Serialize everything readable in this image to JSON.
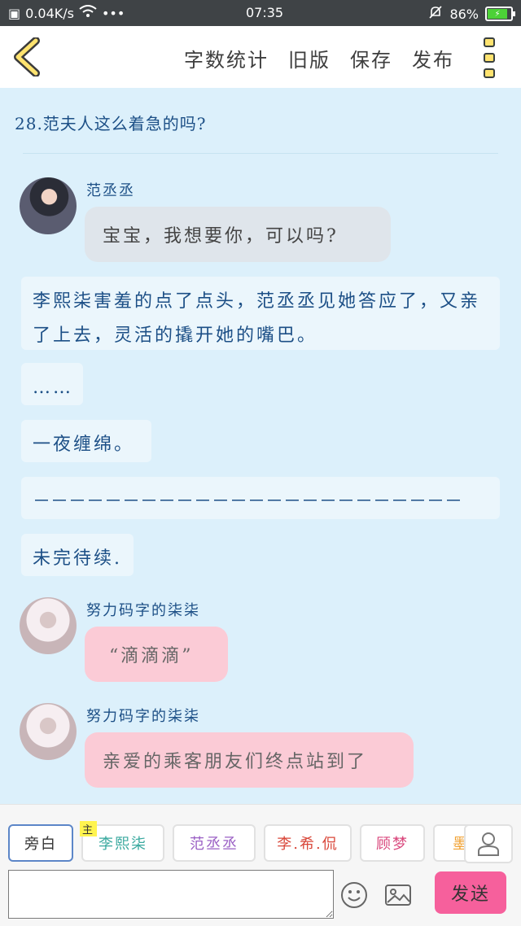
{
  "status_bar": {
    "speed": "0.04K/s",
    "time": "07:35",
    "battery": "86%"
  },
  "header": {
    "actions": [
      "字数统计",
      "旧版",
      "保存",
      "发布"
    ]
  },
  "content": {
    "chapter_title": "28.范夫人这么着急的吗?",
    "messages": [
      {
        "speaker": "范丞丞",
        "text": "宝宝，我想要你，可以吗?"
      },
      {
        "speaker": "努力码字的柒柒",
        "text": "“滴滴滴”"
      },
      {
        "speaker": "努力码字的柒柒",
        "text": "亲爱的乘客朋友们终点站到了"
      }
    ],
    "narrations": [
      "李熙柒害羞的点了点头，范丞丞见她答应了，又亲了上去，灵活的撬开她的嘴巴。",
      "……",
      "一夜缠绵。",
      "－－－－－－－－－－－－－－－－－－－－－－－－",
      "未完待续."
    ]
  },
  "bottom_bar": {
    "roles": [
      {
        "label": "旁白",
        "color": "#444444"
      },
      {
        "label": "李熙柒",
        "color": "#3aa99f",
        "tag": "主"
      },
      {
        "label": "范丞丞",
        "color": "#9a5fc4"
      },
      {
        "label": "李.希.侃",
        "color": "#d9473a"
      },
      {
        "label": "顾梦",
        "color": "#d9477c"
      },
      {
        "label": "墨",
        "color": "#f0a030"
      }
    ],
    "input_value": "",
    "send_label": "发送"
  },
  "colors": {
    "background": "#dcf0fb",
    "accent_pink": "#f6609c",
    "text_blue": "#1c4f86"
  }
}
